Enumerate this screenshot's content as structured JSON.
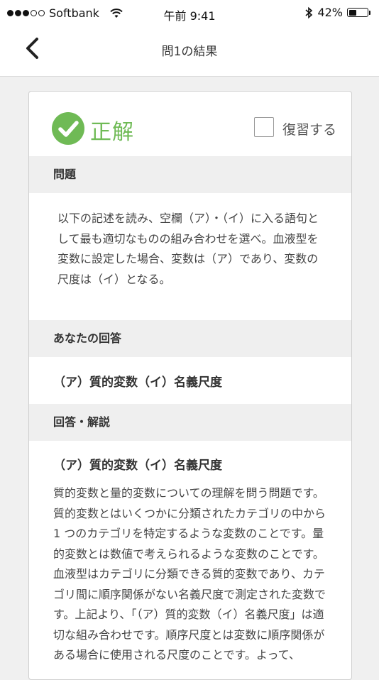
{
  "status_bar": {
    "carrier": "Softbank",
    "time": "午前 9:41",
    "battery_percent": "42%",
    "battery_level": 0.42,
    "signal_bars": 3
  },
  "nav": {
    "title": "問1の結果"
  },
  "result": {
    "status_label": "正解",
    "review_label": "復習する",
    "review_checked": false
  },
  "question_section": {
    "header": "問題",
    "text": "以下の記述を読み、空欄（ア）・（イ）に入る語句として最も適切なものの組み合わせを選べ。血液型を変数に設定した場合、変数は（ア）であり、変数の尺度は（イ）となる。"
  },
  "your_answer_section": {
    "header": "あなたの回答",
    "answer": "（ア）質的変数（イ）名義尺度"
  },
  "explanation_section": {
    "header": "回答・解説",
    "correct_answer": "（ア）質的変数（イ）名義尺度",
    "text": "質的変数と量的変数についての理解を問う問題です。質的変数とはいくつかに分類されたカテゴリの中から 1 つのカテゴリを特定するような変数のことです。量的変数とは数値で考えられるような変数のことです。血液型はカテゴリに分類できる質的変数であり、カテゴリ間に順序関係がない名義尺度で測定された変数です。上記より、「（ア）質的変数（イ）名義尺度」は適切な組み合わせです。順序尺度とは変数に順序関係がある場合に使用される尺度のことです。よって、"
  },
  "colors": {
    "correct_green": "#6fba55",
    "section_bg": "#efefef",
    "page_bg": "#f0f0f0"
  }
}
